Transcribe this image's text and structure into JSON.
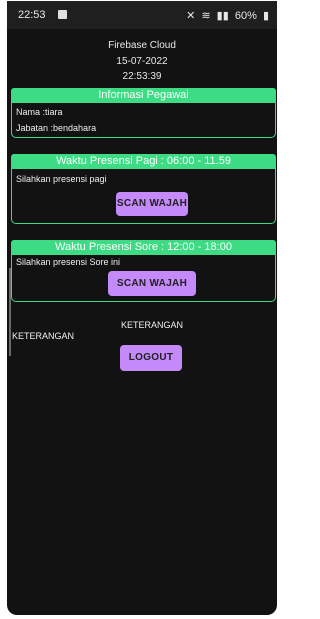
{
  "status": {
    "time": "22:53",
    "battery": "60%"
  },
  "header": {
    "title": "Firebase Cloud",
    "date": "15-07-2022",
    "clock": "22:53:39"
  },
  "info": {
    "title": "Informasi Pegawai",
    "nama": "Nama :tiara",
    "jabatan": "Jabatan :bendahara"
  },
  "pagi": {
    "title": "Waktu Presensi Pagi : 06:00 - 11.59",
    "text": "Silahkan presensi pagi",
    "button": "SCAN WAJAH"
  },
  "sore": {
    "title": "Waktu Presensi Sore : 12:00 - 18:00",
    "text": "Silahkan presensi Sore ini",
    "button": "SCAN WAJAH"
  },
  "keterangan": {
    "center": "KETERANGAN",
    "left": "KETERANGAN"
  },
  "logout": "LOGOUT",
  "colors": {
    "accent": "#3ddc84",
    "button": "#c58af9",
    "background": "#121212"
  }
}
